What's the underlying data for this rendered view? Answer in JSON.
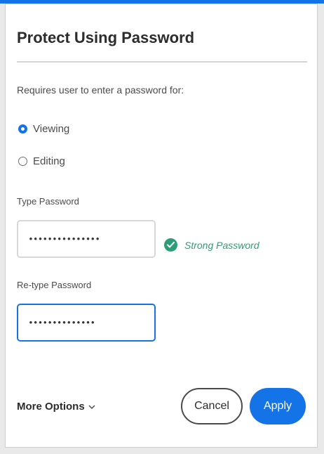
{
  "dialog": {
    "title": "Protect Using Password",
    "subtitle": "Requires user to enter a password for:",
    "options": [
      {
        "label": "Viewing",
        "selected": true
      },
      {
        "label": "Editing",
        "selected": false
      }
    ],
    "password": {
      "label": "Type Password",
      "value": "•••••••••••••••",
      "strength": "Strong Password"
    },
    "retype": {
      "label": "Re-type Password",
      "value": "••••••••••••••"
    },
    "more_options": "More Options",
    "cancel_label": "Cancel",
    "apply_label": "Apply"
  },
  "colors": {
    "accent": "#1473e6",
    "success": "#2d9d78"
  },
  "icons": {
    "strength": "checkmark-circle-icon",
    "more": "chevron-down-icon"
  }
}
